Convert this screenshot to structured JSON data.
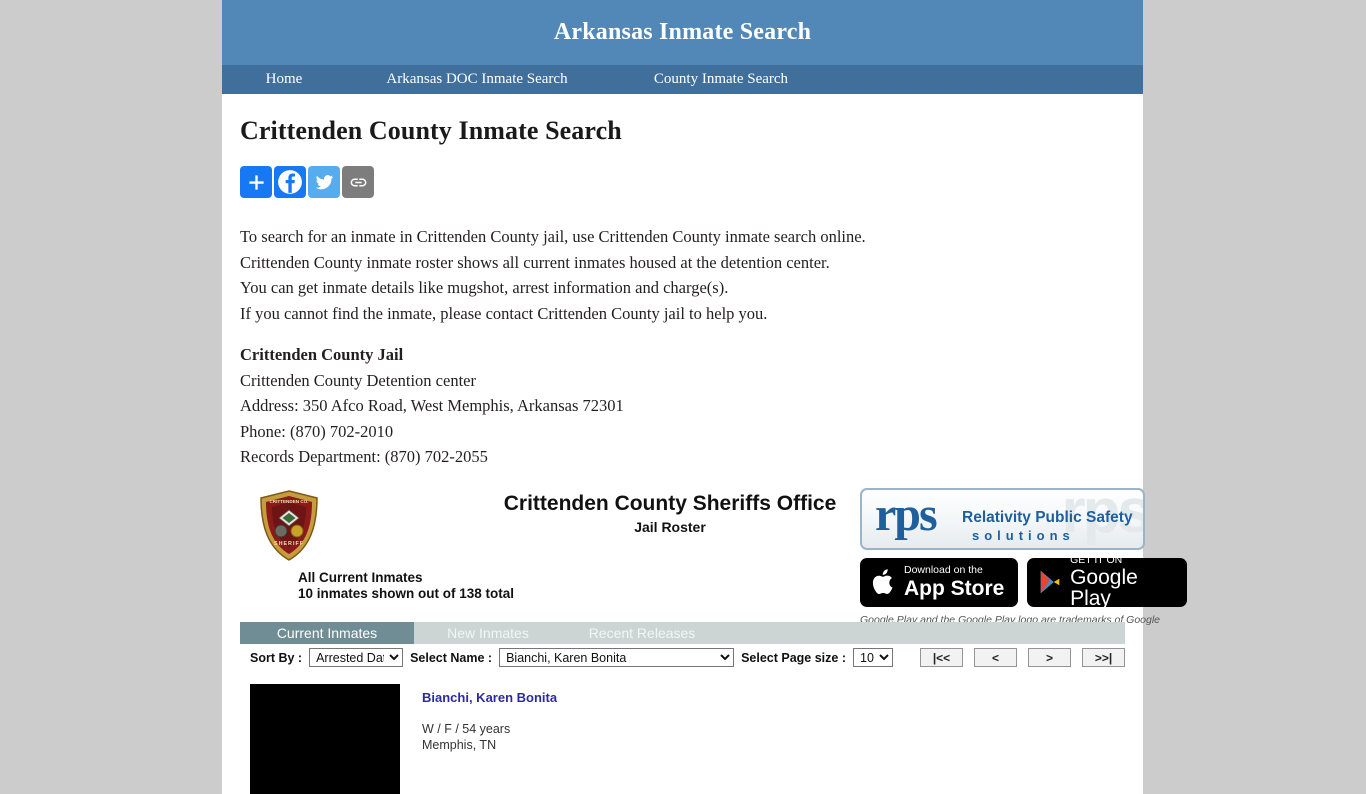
{
  "site": {
    "title": "Arkansas Inmate Search",
    "nav": [
      {
        "label": "Home"
      },
      {
        "label": "Arkansas DOC Inmate Search"
      },
      {
        "label": "County Inmate Search"
      }
    ]
  },
  "page_title": "Crittenden County Inmate Search",
  "share": [
    {
      "name": "share-plus",
      "label": "Share",
      "color": "#1678f2"
    },
    {
      "name": "facebook",
      "label": "Facebook",
      "color": "#1877f2"
    },
    {
      "name": "twitter",
      "label": "Twitter",
      "color": "#55acee"
    },
    {
      "name": "copy-link",
      "label": "Copy Link",
      "color": "#7d7d7d"
    }
  ],
  "intro": [
    "To search for an inmate in Crittenden County jail, use Crittenden County inmate search online.",
    "Crittenden County inmate roster shows all current inmates housed at the detention center.",
    "You can get inmate details like mugshot, arrest information and charge(s).",
    "If you cannot find the inmate, please contact Crittenden County jail to help you."
  ],
  "jail": {
    "name": "Crittenden County Jail",
    "facility": "Crittenden County Detention center",
    "address": "Address: 350 Afco Road, West Memphis, Arkansas 72301",
    "phone": "Phone: (870) 702-2010",
    "records": "Records Department: (870) 702-2055"
  },
  "roster": {
    "badge_top_text": "CRITTENDEN CO.",
    "badge_bottom_text": "SHERIFF",
    "heading": "Crittenden County Sheriffs Office",
    "subheading": "Jail Roster",
    "count_line1": "All Current Inmates",
    "count_line2": "10 inmates shown out of 138 total",
    "rps": {
      "mark": "rps",
      "line1": "Relativity Public Safety",
      "line2": "solutions",
      "ghost": "rps"
    },
    "stores": {
      "apple_small": "Download on the",
      "apple_big": "App Store",
      "google_small": "GET IT ON",
      "google_big": "Google Play"
    },
    "trademark": "Google Play and the Google Play logo are trademarks of Google LLC."
  },
  "tabs": [
    {
      "label": "Current Inmates",
      "active": true
    },
    {
      "label": "New Inmates",
      "active": false
    },
    {
      "label": "Recent Releases",
      "active": false
    }
  ],
  "controls": {
    "sort_label": "Sort By :",
    "sort_value": "Arrested Date",
    "name_label": "Select Name :",
    "name_value": "Bianchi, Karen Bonita",
    "pagesize_label": "Select Page size :",
    "pagesize_value": "10",
    "pager": [
      {
        "label": "|<<",
        "name": "first-page-button"
      },
      {
        "label": "<",
        "name": "prev-page-button"
      },
      {
        "label": ">",
        "name": "next-page-button"
      },
      {
        "label": ">>|",
        "name": "last-page-button"
      }
    ]
  },
  "inmates": [
    {
      "name": "Bianchi, Karen Bonita",
      "demographics": "W / F / 54 years",
      "location": "Memphis, TN"
    }
  ]
}
